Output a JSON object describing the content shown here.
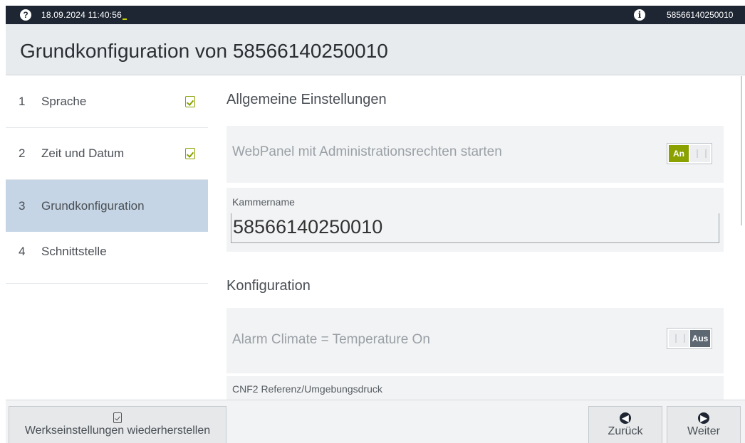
{
  "statusbar": {
    "help_icon": "?",
    "datetime": "18.09.2024 11:40:56",
    "info_icon": "i",
    "serial": "58566140250010"
  },
  "header": {
    "title": "Grundkonfiguration von 58566140250010"
  },
  "steps": [
    {
      "num": "1",
      "label": "Sprache",
      "done": true
    },
    {
      "num": "2",
      "label": "Zeit und Datum",
      "done": true
    },
    {
      "num": "3",
      "label": "Grundkonfiguration",
      "active": true
    },
    {
      "num": "4",
      "label": "Schnittstelle"
    }
  ],
  "main": {
    "general_title": "Allgemeine Einstellungen",
    "webpanel": {
      "label": "WebPanel mit Administrationsrechten starten",
      "state": "An"
    },
    "chamber": {
      "label": "Kammername",
      "value": "58566140250010"
    },
    "config_title": "Konfiguration",
    "alarm": {
      "label": "Alarm Climate = Temperature On",
      "state": "Aus"
    },
    "cnf2": {
      "label": "CNF2 Referenz/Umgebungsdruck"
    }
  },
  "footer": {
    "reset_label": "Werkseinstellungen wiederherstellen",
    "back_label": "Zurück",
    "next_label": "Weiter"
  },
  "colors": {
    "accent": "#8aa100",
    "topbar": "#1e2633",
    "active_step": "#c6d5e5"
  }
}
